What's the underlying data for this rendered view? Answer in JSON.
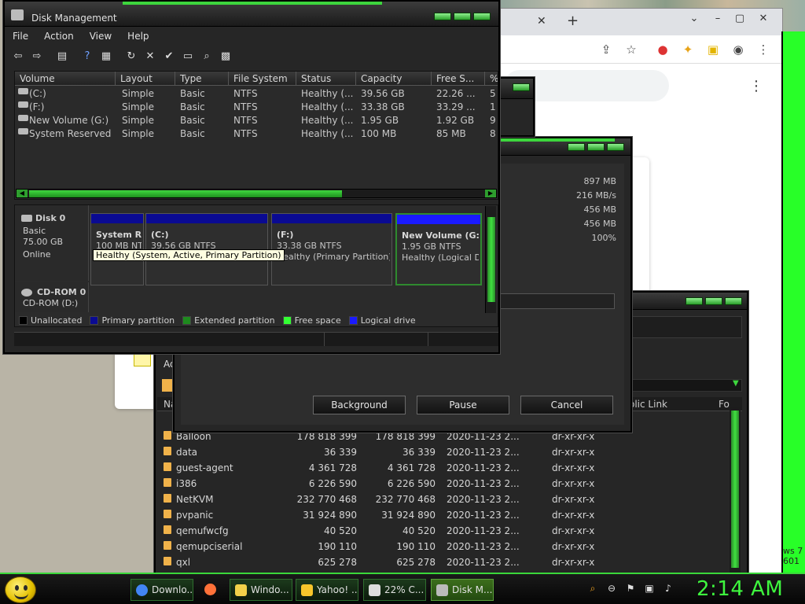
{
  "disk_mgmt": {
    "title": "Disk Management",
    "menu": [
      "File",
      "Action",
      "View",
      "Help"
    ],
    "columns": [
      "Volume",
      "Layout",
      "Type",
      "File System",
      "Status",
      "Capacity",
      "Free S...",
      "%"
    ],
    "volumes": [
      {
        "name": "(C:)",
        "layout": "Simple",
        "type": "Basic",
        "fs": "NTFS",
        "status": "Healthy (...",
        "capacity": "39.56 GB",
        "free": "22.26 ...",
        "pct": "5"
      },
      {
        "name": "(F:)",
        "layout": "Simple",
        "type": "Basic",
        "fs": "NTFS",
        "status": "Healthy (...",
        "capacity": "33.38 GB",
        "free": "33.29 ...",
        "pct": "1"
      },
      {
        "name": "New Volume (G:)",
        "layout": "Simple",
        "type": "Basic",
        "fs": "NTFS",
        "status": "Healthy (...",
        "capacity": "1.95 GB",
        "free": "1.92 GB",
        "pct": "9"
      },
      {
        "name": "System Reserved",
        "layout": "Simple",
        "type": "Basic",
        "fs": "NTFS",
        "status": "Healthy (...",
        "capacity": "100 MB",
        "free": "85 MB",
        "pct": "8"
      }
    ],
    "disk0": {
      "name": "Disk 0",
      "kind": "Basic",
      "size": "75.00 GB",
      "state": "Online"
    },
    "partitions": [
      {
        "title": "System R",
        "size": "100 MB NT",
        "status": ""
      },
      {
        "title": "(C:)",
        "size": "39.56 GB NTFS",
        "status": "s"
      },
      {
        "title": "(F:)",
        "size": "33.38 GB NTFS",
        "status": "Healthy (Primary Partition)"
      },
      {
        "title": "New Volume  (G:",
        "size": "1.95 GB NTFS",
        "status": "Healthy (Logical Dr"
      }
    ],
    "tooltip": "Healthy (System, Active, Primary Partition)",
    "cdrom": {
      "name": "CD-ROM 0",
      "drive": "CD-ROM (D:)"
    },
    "legend": [
      {
        "label": "Unallocated",
        "color": "#000000"
      },
      {
        "label": "Primary partition",
        "color": "#0a0a92"
      },
      {
        "label": "Extended partition",
        "color": "#1e8a1e"
      },
      {
        "label": "Free space",
        "color": "#33ff33"
      },
      {
        "label": "Logical drive",
        "color": "#1a1aff"
      }
    ]
  },
  "transfer": {
    "stats": [
      "897 MB",
      "216 MB/s",
      "456 MB",
      "456 MB",
      "100%"
    ],
    "buttons": {
      "background": "Background",
      "pause": "Pause",
      "cancel": "Cancel"
    }
  },
  "file_manager": {
    "header_cols": [
      "Na",
      "olic Link",
      "Fo"
    ],
    "tab": "Ad",
    "rows": [
      {
        "name": "Balloon",
        "size1": "178 818 399",
        "size2": "178 818 399",
        "date": "2020-11-23 2...",
        "attr": "dr-xr-xr-x"
      },
      {
        "name": "data",
        "size1": "36 339",
        "size2": "36 339",
        "date": "2020-11-23 2...",
        "attr": "dr-xr-xr-x"
      },
      {
        "name": "guest-agent",
        "size1": "4 361 728",
        "size2": "4 361 728",
        "date": "2020-11-23 2...",
        "attr": "dr-xr-xr-x"
      },
      {
        "name": "i386",
        "size1": "6 226 590",
        "size2": "6 226 590",
        "date": "2020-11-23 2...",
        "attr": "dr-xr-xr-x"
      },
      {
        "name": "NetKVM",
        "size1": "232 770 468",
        "size2": "232 770 468",
        "date": "2020-11-23 2...",
        "attr": "dr-xr-xr-x"
      },
      {
        "name": "pvpanic",
        "size1": "31 924 890",
        "size2": "31 924 890",
        "date": "2020-11-23 2...",
        "attr": "dr-xr-xr-x"
      },
      {
        "name": "qemufwcfg",
        "size1": "40 520",
        "size2": "40 520",
        "date": "2020-11-23 2...",
        "attr": "dr-xr-xr-x"
      },
      {
        "name": "qemupciserial",
        "size1": "190 110",
        "size2": "190 110",
        "date": "2020-11-23 2...",
        "attr": "dr-xr-xr-x"
      },
      {
        "name": "qxl",
        "size1": "625 278",
        "size2": "625 278",
        "date": "2020-11-23 2...",
        "attr": "dr-xr-xr-x"
      }
    ]
  },
  "desktop": {
    "ws_text": "ws 7\n601"
  },
  "taskbar": {
    "tasks": [
      {
        "label": "Downlo...",
        "icon_color": "#4285f4"
      },
      {
        "label": "",
        "icon_color": "#ff7139"
      },
      {
        "label": "Windo...",
        "icon_color": "#f2d04a"
      },
      {
        "label": "Yahoo! ...",
        "icon_color": "#f7c52b"
      },
      {
        "label": "22% C...",
        "icon_color": "#dddddd"
      },
      {
        "label": "Disk M...",
        "icon_color": "#bbbbbb"
      }
    ],
    "clock": "2:14 AM"
  }
}
